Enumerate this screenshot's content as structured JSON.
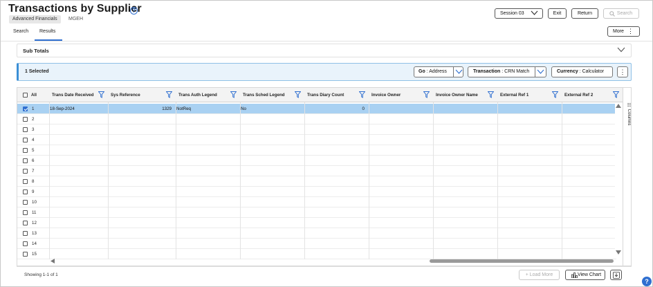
{
  "header": {
    "title": "Transactions by Supplier",
    "module": "Advanced Financials",
    "tenant": "MGEH",
    "session_label": "Session 03",
    "exit_label": "Exit",
    "return_label": "Return",
    "search_label": "Search",
    "more_label": "More"
  },
  "tabs": [
    {
      "label": "Search",
      "active": false
    },
    {
      "label": "Results",
      "active": true
    }
  ],
  "subtotals": {
    "label": "Sub Totals"
  },
  "selection_bar": {
    "count_label": "1 Selected",
    "go": {
      "label": "Go",
      "value": "Address"
    },
    "transaction": {
      "label": "Transaction",
      "value": "CRN Match"
    },
    "currency": {
      "label": "Currency",
      "value": "Calculator"
    }
  },
  "grid": {
    "select_all_label": "All",
    "columns": [
      "Trans Date Received",
      "Sys Reference",
      "Trans Auth Legend",
      "Trans Sched Legend",
      "Trans Diary Count",
      "Invoice Owner",
      "Invoice Owner Name",
      "External Ref 1",
      "External Ref 2"
    ],
    "rows": [
      {
        "num": "1",
        "selected": true,
        "cells": [
          "18-Sep-2024",
          "1329",
          "NotReq",
          "No",
          "0",
          "",
          "",
          "",
          ""
        ]
      },
      {
        "num": "2",
        "selected": false,
        "cells": []
      },
      {
        "num": "3",
        "selected": false,
        "cells": []
      },
      {
        "num": "4",
        "selected": false,
        "cells": []
      },
      {
        "num": "5",
        "selected": false,
        "cells": []
      },
      {
        "num": "6",
        "selected": false,
        "cells": []
      },
      {
        "num": "7",
        "selected": false,
        "cells": []
      },
      {
        "num": "8",
        "selected": false,
        "cells": []
      },
      {
        "num": "9",
        "selected": false,
        "cells": []
      },
      {
        "num": "10",
        "selected": false,
        "cells": []
      },
      {
        "num": "11",
        "selected": false,
        "cells": []
      },
      {
        "num": "12",
        "selected": false,
        "cells": []
      },
      {
        "num": "13",
        "selected": false,
        "cells": []
      },
      {
        "num": "14",
        "selected": false,
        "cells": []
      },
      {
        "num": "15",
        "selected": false,
        "cells": []
      }
    ],
    "side_panel_label": "Columns"
  },
  "footer": {
    "showing": "Showing 1-1 of 1",
    "load_more_label": "Load More",
    "view_chart_label": "View Chart"
  },
  "colors": {
    "accent": "#2f6fd0",
    "selection": "#a9d1f2",
    "selbar_bg": "#e9f3fb"
  }
}
